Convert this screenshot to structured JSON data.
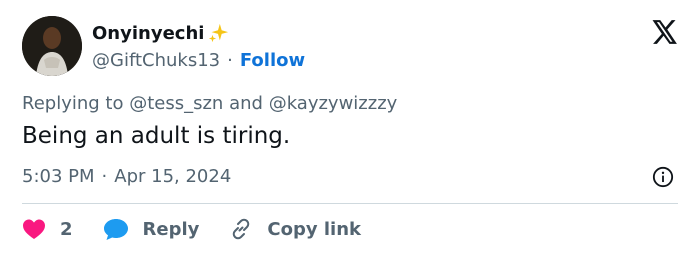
{
  "user": {
    "display_name": "Onyinyechi",
    "handle": "@GiftChuks13",
    "follow_label": "Follow"
  },
  "reply_context": {
    "prefix": "Replying to",
    "mention_1": "@tess_szn",
    "conjunction": "and",
    "mention_2": "@kayzywizzzy"
  },
  "tweet": {
    "text": "Being an adult is tiring.",
    "time": "5:03 PM",
    "date": "Apr 15, 2024"
  },
  "actions": {
    "like_count": "2",
    "reply_label": "Reply",
    "copy_link_label": "Copy link"
  },
  "icons": {
    "sparkle": "sparkles-icon",
    "logo": "x-logo-icon",
    "info": "info-icon",
    "like": "heart-icon",
    "reply": "chat-bubble-icon",
    "copy": "link-icon"
  },
  "colors": {
    "follow": "#0f73d8",
    "heart": "#f91880",
    "reply_bubble": "#1d9bf0",
    "muted": "#536471"
  }
}
